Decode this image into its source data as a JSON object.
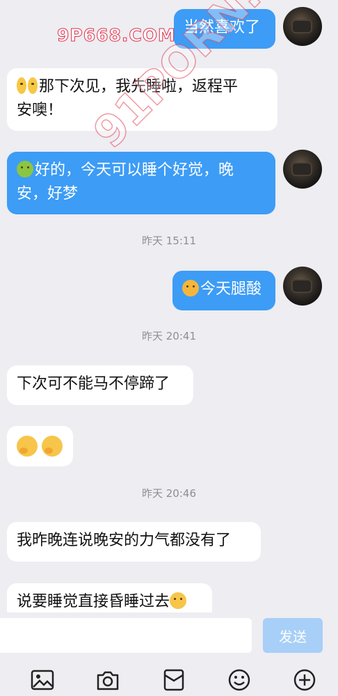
{
  "messages": [
    {
      "side": "right",
      "text": "当然喜欢了"
    },
    {
      "side": "left",
      "text": "那下次见，我先睡啦，返程平安噢！",
      "line1": "那下次见，我先睡啦，返程平",
      "line2": "安噢！"
    },
    {
      "side": "right",
      "text": "好的，今天可以睡个好觉，晚安，好梦",
      "line1": "好的，今天可以睡个好觉，晚",
      "line2": "安，好梦"
    },
    {
      "side": "right",
      "text": "今天腿酸"
    },
    {
      "side": "left",
      "text": "下次可不能马不停蹄了"
    },
    {
      "side": "left",
      "text": "",
      "emoji": "yawn x2"
    },
    {
      "side": "left",
      "text": "我昨晚连说晚安的力气都没有了"
    },
    {
      "side": "left",
      "text": "说要睡觉直接昏睡过去"
    }
  ],
  "timestamps": [
    "昨天 15:11",
    "昨天 20:41",
    "昨天 20:46"
  ],
  "watermarks": {
    "top": "9P668.COM",
    "diagonal": "91PORN.COM"
  },
  "input": {
    "value": "",
    "send_label": "发送"
  },
  "toolbar": {
    "icons": [
      "image-icon",
      "camera-icon",
      "red-packet-icon",
      "emoji-icon",
      "plus-circle-icon"
    ]
  },
  "colors": {
    "right_bubble": "#3d9cf5",
    "left_bubble": "#ffffff",
    "background": "#ededf2",
    "send_button": "#a7cff7"
  }
}
